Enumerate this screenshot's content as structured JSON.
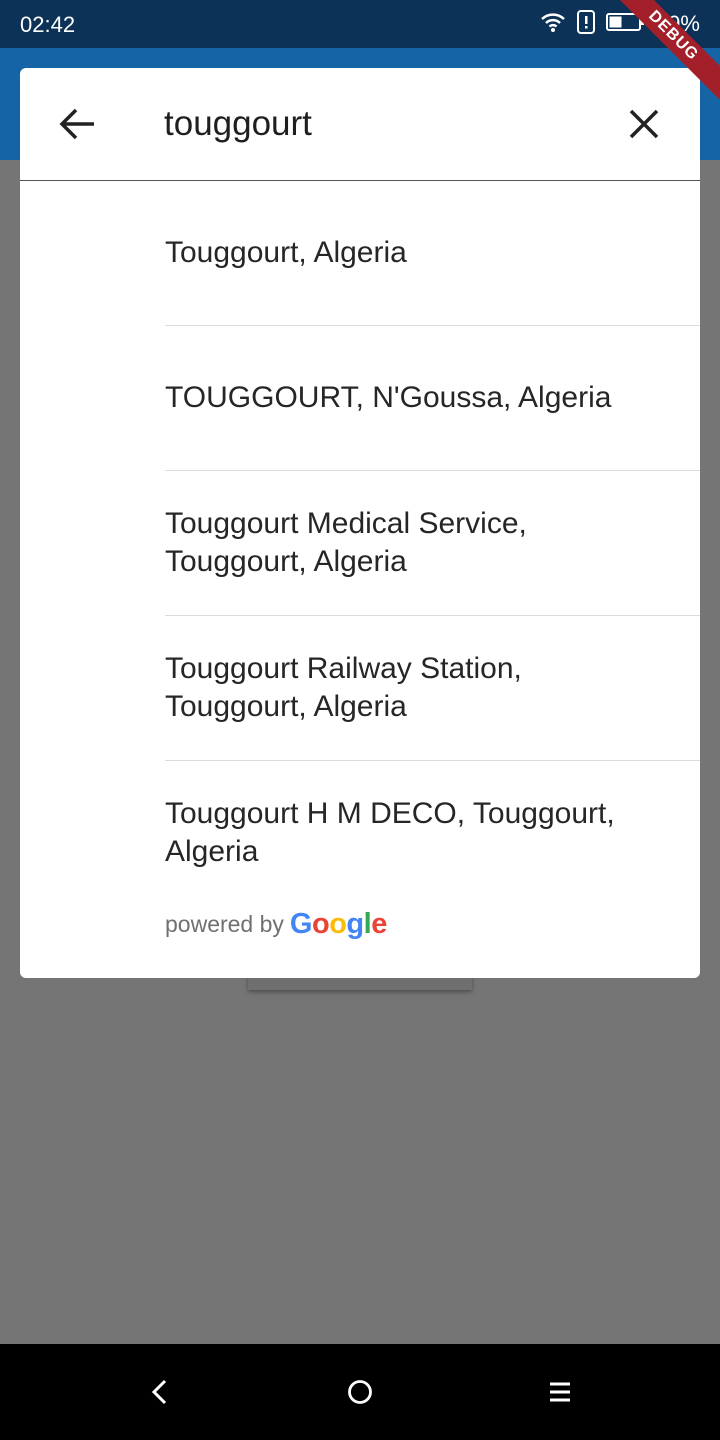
{
  "status_bar": {
    "time": "02:42",
    "battery": "39%",
    "icons": [
      "wifi-icon",
      "sim-alert-icon",
      "battery-icon"
    ]
  },
  "debug_banner": "DEBUG",
  "search": {
    "query": "touggourt",
    "back_icon": "arrow-back-icon",
    "clear_icon": "close-icon"
  },
  "results": [
    {
      "label": "Touggourt, Algeria"
    },
    {
      "label": "TOUGGOURT, N'Goussa, Algeria"
    },
    {
      "label": "Touggourt Medical Service, Touggourt, Algeria"
    },
    {
      "label": "Touggourt Railway Station, Touggourt, Algeria"
    },
    {
      "label": "Touggourt H M DECO, Touggourt, Algeria"
    }
  ],
  "attribution": {
    "powered_by": "powered by",
    "google_letters": [
      "G",
      "o",
      "o",
      "g",
      "l",
      "e"
    ],
    "google_colors": [
      "#4285F4",
      "#EA4335",
      "#FBBC05",
      "#4285F4",
      "#34A853",
      "#EA4335"
    ]
  },
  "colors": {
    "status_bar": "#0d3257",
    "app_bar": "#1565a6",
    "scrim": "#757575",
    "debug_banner": "#a3202a"
  },
  "nav_bar": {
    "icons": [
      "nav-back-icon",
      "nav-home-icon",
      "nav-menu-icon"
    ]
  }
}
